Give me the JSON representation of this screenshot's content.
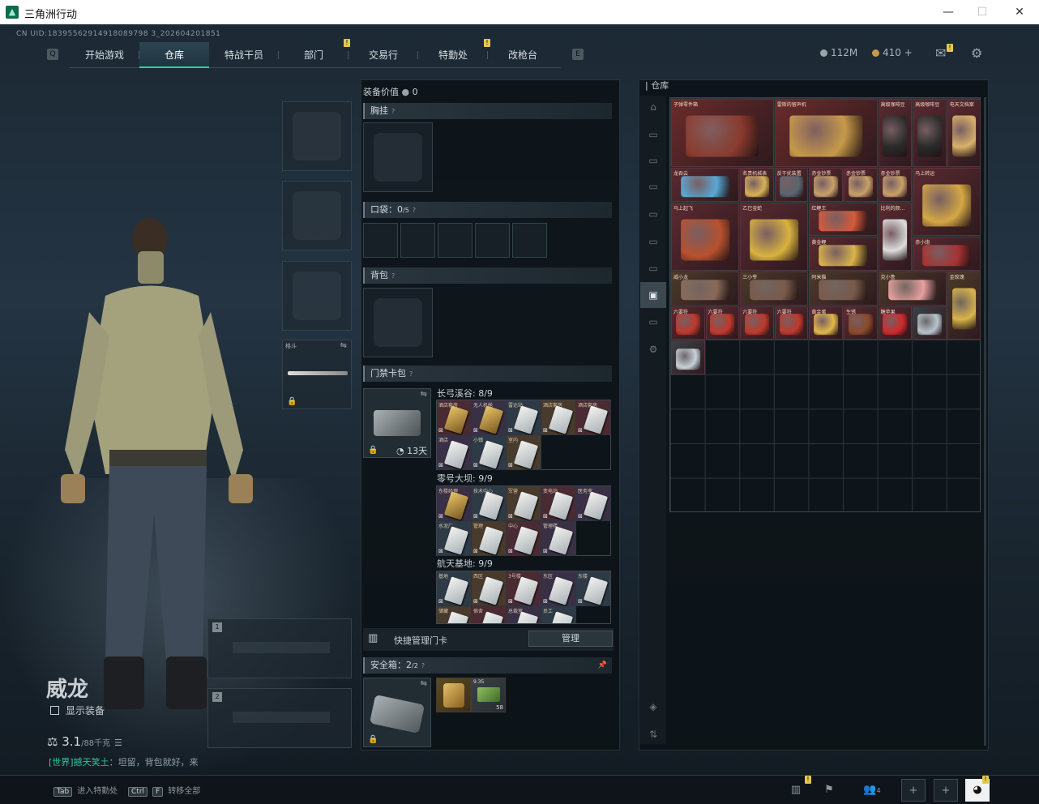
{
  "window": {
    "title": "三角洲行动",
    "minimize": "—",
    "maximize": "☐",
    "close": "✕"
  },
  "uid": "CN UID:18395562914918089798 3_202604201851",
  "nav": {
    "left_key": "Q",
    "right_key": "E",
    "tabs": [
      "开始游戏",
      "仓库",
      "特战干员",
      "部门",
      "交易行",
      "特勤处",
      "改枪台"
    ],
    "active": "仓库"
  },
  "currency": {
    "money": "112M",
    "coins": "410 +"
  },
  "character": {
    "name": "威龙",
    "show_equipment": "显示装备",
    "weight": "3.1",
    "weight_max": "/88千克"
  },
  "world_message": {
    "prefix": "[世界]",
    "sender": "撼天笑土",
    "text": "：坦留，背包就好，来"
  },
  "bottom": {
    "key1": "Tab",
    "key1_label": "进入特勤处",
    "key2a": "Ctrl",
    "key2b": "F",
    "key2_label": "转移全部",
    "friends": "4"
  },
  "weapon_slots": [
    {
      "num": "1"
    },
    {
      "num": "2"
    }
  ],
  "melee_label": "格斗",
  "middle": {
    "equip_value_label": "装备价值",
    "equip_value": "0",
    "chest_rig": "胸挂",
    "pockets": "口袋：",
    "pockets_count": "0",
    "pockets_max": "/5",
    "backpack": "背包",
    "keycard_case": "门禁卡包",
    "keycase_days": "13天",
    "maps": [
      {
        "name": "长弓溪谷: 8/9",
        "cards": [
          "酒店套房",
          "无人机舱",
          "雷达站",
          "酒店套房",
          "酒店套房",
          "酒店",
          "小镇",
          "室内"
        ]
      },
      {
        "name": "零号大坝: 9/9",
        "cards": [
          "东楼经理",
          "技术中心",
          "军营",
          "变电站",
          "医务室",
          "水泥厂",
          "管理",
          "中心",
          "管理楼"
        ]
      },
      {
        "name": "航天基地: 9/9",
        "cards": [
          "基地",
          "西区",
          "3号楼",
          "东区",
          "东楼",
          "储藏",
          "宿舍",
          "总裁室",
          "员工"
        ]
      }
    ],
    "quick_manage": "快捷管理门卡",
    "manage_btn": "管理",
    "safebox": "安全箱：",
    "safebox_count": "2",
    "safebox_max": "/2",
    "safe_items": [
      {
        "name": "",
        "count": ""
      },
      {
        "name": "9.35",
        "count": "58"
      }
    ]
  },
  "warehouse": {
    "title": "仓库",
    "items": [
      {
        "name": "子弹零件箱",
        "icon": "ammo-parts-box"
      },
      {
        "name": "雷斯的留声机",
        "icon": "gramophone"
      },
      {
        "name": "高级咖啡豆",
        "icon": "coffee-bag"
      },
      {
        "name": "高级咖啡豆",
        "icon": "coffee-bag"
      },
      {
        "name": "电天文档案",
        "icon": "document"
      },
      {
        "name": "龙吞云",
        "icon": "key"
      },
      {
        "name": "名贵机械表",
        "icon": "watch"
      },
      {
        "name": "反干扰装置",
        "icon": "device"
      },
      {
        "name": "赤金钞票",
        "icon": "cash"
      },
      {
        "name": "赤金钞票",
        "icon": "cash"
      },
      {
        "name": "赤金钞票",
        "icon": "cash"
      },
      {
        "name": "马上转运",
        "icon": "gold-wheel"
      },
      {
        "name": "马上起飞",
        "icon": "red-horse"
      },
      {
        "name": "乙巳金蛇",
        "icon": "gold-snake"
      },
      {
        "name": "红鲤王",
        "icon": "red-carp"
      },
      {
        "name": "比利的颜…",
        "icon": "puppet"
      },
      {
        "name": "黄金鲤",
        "icon": "gold-carp"
      },
      {
        "name": "赤小炮",
        "icon": "firecracker"
      },
      {
        "name": "威小龙",
        "icon": "toy-dragon"
      },
      {
        "name": "三小爷",
        "icon": "toy"
      },
      {
        "name": "阿米猫",
        "icon": "toy"
      },
      {
        "name": "克小鲁",
        "icon": "toy-pig"
      },
      {
        "name": "金玫瑰",
        "icon": "gold-rose"
      },
      {
        "name": "六要符",
        "icon": "red-bag"
      },
      {
        "name": "六要符",
        "icon": "red-bag"
      },
      {
        "name": "六要符",
        "icon": "red-bag"
      },
      {
        "name": "六要符",
        "icon": "red-bag"
      },
      {
        "name": "黄金蛋",
        "icon": "gold-egg"
      },
      {
        "name": "生锈",
        "icon": "ornament"
      },
      {
        "name": "糖苹果",
        "icon": "apple"
      },
      {
        "name": "",
        "icon": "card"
      },
      {
        "name": "",
        "icon": "photo"
      }
    ]
  },
  "colors": {
    "accent": "#2bd49a",
    "badge": "#e4c84d",
    "item_red": "#5a2a31"
  }
}
